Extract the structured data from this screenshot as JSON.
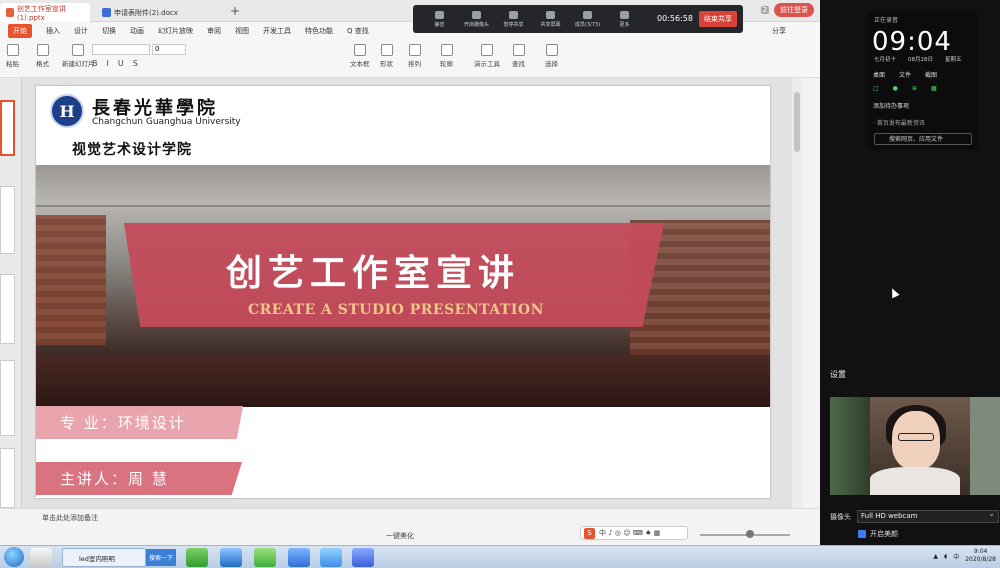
{
  "tabs": [
    {
      "label": "创艺工作室宣讲(1).pptx"
    },
    {
      "label": "申请表附件(2).docx"
    }
  ],
  "new_tab": "+",
  "login_label": "前往登录",
  "menu": [
    "开始",
    "插入",
    "设计",
    "切换",
    "动画",
    "幻灯片放映",
    "审阅",
    "视图",
    "开发工具",
    "特色功能",
    "Q 查找"
  ],
  "share_label": "分享",
  "ribbon": {
    "paste": "粘贴",
    "new_slide": "新建幻灯片",
    "format": "格式",
    "section": "节",
    "reset": "重置",
    "font_size": "0",
    "textbox": "文本框",
    "shape": "形状",
    "arrange": "排列",
    "outline": "轮廓",
    "present": "演示工具",
    "replace": "替换",
    "find": "查找",
    "select": "选择"
  },
  "meeting": {
    "buttons": [
      "静音",
      "开启摄像头",
      "暂停共享",
      "共享屏幕",
      "成员(3/73)",
      "更多"
    ],
    "timer": "00:56:58",
    "end_share": "结束共享"
  },
  "slide": {
    "logo_letter": "H",
    "university_cn": "長春光華學院",
    "university_en": "Changchun Guanghua University",
    "college": "视觉艺术设计学院",
    "title_cn": "创艺工作室宣讲",
    "title_en": "CREATE A STUDIO PRESENTATION",
    "major": "专  业：环境设计",
    "speaker": "主讲人：周  慧"
  },
  "statusbar": {
    "note_hint": "单击此处添加备注",
    "view_mode": "一键美化"
  },
  "clock_widget": {
    "status": "正在录音",
    "time": "09:04",
    "date_lunar": "七月初十",
    "date_solar": "08月28日",
    "weekday": "星期五",
    "row1": [
      "桌面",
      "文件",
      "截图"
    ],
    "hint": "添加待办事项",
    "news": "· 首页发布最新资讯",
    "search": "搜索网页、应用文件"
  },
  "settings_label": "设置",
  "camera_label": "摄像头",
  "camera_value": "Full HD webcam",
  "beauty_label": "开启美颜",
  "taskbar": {
    "ie_item": "led室内照明",
    "search_btn": "搜索一下",
    "time": "9:04",
    "date": "2020/8/28"
  },
  "colors": {
    "accent": "#e8532e",
    "banner": "#c44b5b",
    "strip_light": "#e9a5ae",
    "strip_dark": "#d8737f",
    "meeting_end": "#d9423b"
  }
}
